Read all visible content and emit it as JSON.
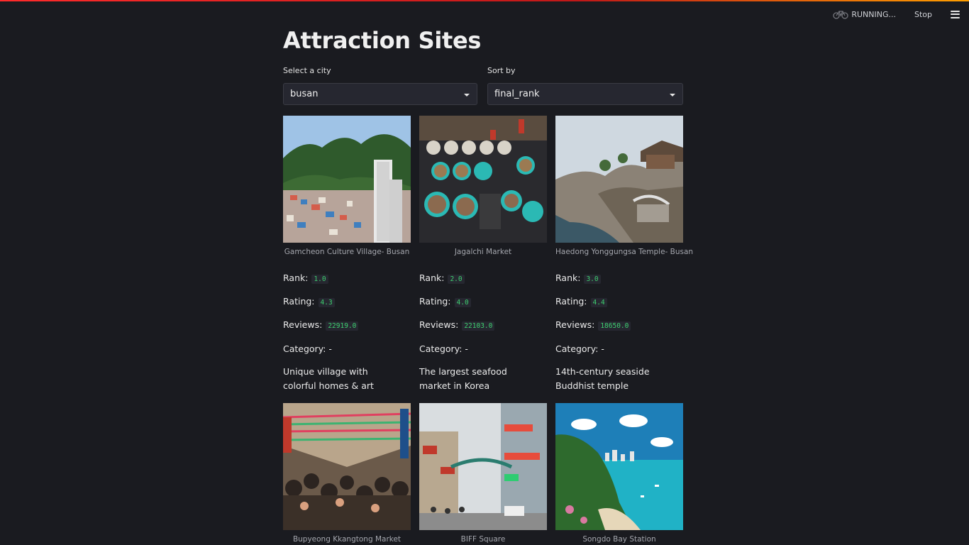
{
  "status": {
    "running_label": "RUNNING...",
    "stop_label": "Stop"
  },
  "page_title": "Attraction Sites",
  "city_select": {
    "label": "Select a city",
    "value": "busan"
  },
  "sort_select": {
    "label": "Sort by",
    "value": "final_rank"
  },
  "labels": {
    "rank": "Rank:",
    "rating": "Rating:",
    "reviews": "Reviews:",
    "category": "Category: -"
  },
  "sites": [
    {
      "name": "Gamcheon Culture Village- Busan",
      "rank": "1.0",
      "rating": "4.3",
      "reviews": "22919.0",
      "description": "Unique village with colorful homes & art"
    },
    {
      "name": "Jagalchi Market",
      "rank": "2.0",
      "rating": "4.0",
      "reviews": "22103.0",
      "description": "The largest seafood market in Korea"
    },
    {
      "name": "Haedong Yonggungsa Temple- Busan",
      "rank": "3.0",
      "rating": "4.4",
      "reviews": "18650.0",
      "description": "14th-century seaside Buddhist temple"
    },
    {
      "name": "Bupyeong Kkangtong Market"
    },
    {
      "name": "BIFF Square"
    },
    {
      "name": "Songdo Bay Station"
    }
  ]
}
